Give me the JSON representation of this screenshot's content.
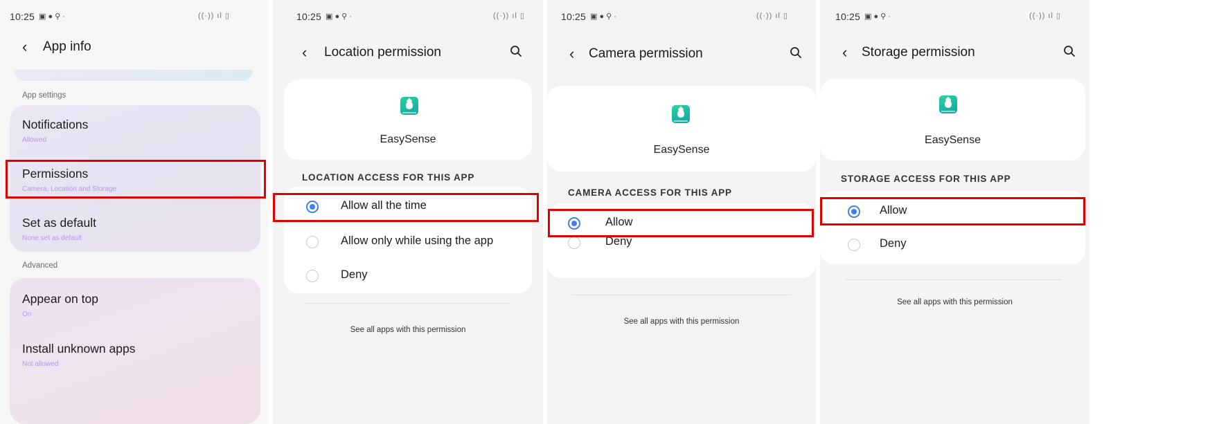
{
  "status_bar": {
    "time": "10:25"
  },
  "app_info": {
    "title": "App info",
    "section_app_settings": "App settings",
    "section_advanced": "Advanced",
    "items": [
      {
        "title": "Notifications",
        "subtitle": "Allowed"
      },
      {
        "title": "Permissions",
        "subtitle": "Camera, Location and Storage"
      },
      {
        "title": "Set as default",
        "subtitle": "None set as default"
      },
      {
        "title": "Appear on top",
        "subtitle": "On"
      },
      {
        "title": "Install unknown apps",
        "subtitle": "Not allowed"
      }
    ]
  },
  "location": {
    "title": "Location permission",
    "app_name": "EasySense",
    "access_header": "LOCATION ACCESS FOR THIS APP",
    "options": [
      "Allow all the time",
      "Allow only while using the app",
      "Deny"
    ],
    "selected": "Allow all the time",
    "see_all": "See all apps with this permission"
  },
  "camera": {
    "title": "Camera permission",
    "app_name": "EasySense",
    "access_header": "CAMERA ACCESS FOR THIS APP",
    "options": [
      "Allow",
      "Deny"
    ],
    "selected": "Allow",
    "see_all": "See all apps with this permission"
  },
  "storage": {
    "title": "Storage permission",
    "app_name": "EasySense",
    "access_header": "STORAGE ACCESS FOR THIS APP",
    "options": [
      "Allow",
      "Deny"
    ],
    "selected": "Allow",
    "see_all": "See all apps with this permission"
  },
  "colors": {
    "highlight": "#e00000",
    "radio_accent": "#3f7ff0",
    "subtitle": "#b59bea",
    "app_icon": "#1fbf9f"
  },
  "icons": [
    "back-chevron-icon",
    "search-icon",
    "radio-selected-icon",
    "radio-unselected-icon",
    "easysense-app-icon"
  ]
}
